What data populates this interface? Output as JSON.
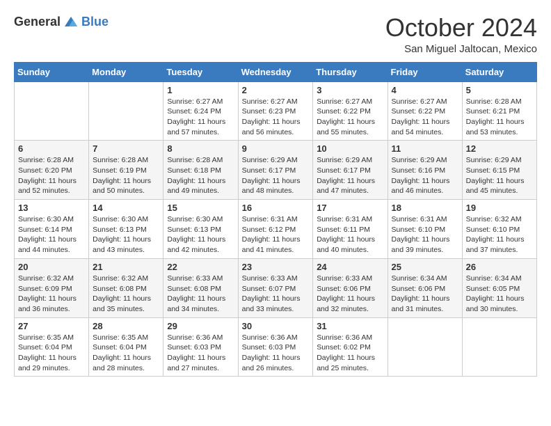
{
  "header": {
    "logo_general": "General",
    "logo_blue": "Blue",
    "month_title": "October 2024",
    "location": "San Miguel Jaltocan, Mexico"
  },
  "days_of_week": [
    "Sunday",
    "Monday",
    "Tuesday",
    "Wednesday",
    "Thursday",
    "Friday",
    "Saturday"
  ],
  "weeks": [
    [
      {
        "day": "",
        "info": ""
      },
      {
        "day": "",
        "info": ""
      },
      {
        "day": "1",
        "info": "Sunrise: 6:27 AM\nSunset: 6:24 PM\nDaylight: 11 hours and 57 minutes."
      },
      {
        "day": "2",
        "info": "Sunrise: 6:27 AM\nSunset: 6:23 PM\nDaylight: 11 hours and 56 minutes."
      },
      {
        "day": "3",
        "info": "Sunrise: 6:27 AM\nSunset: 6:22 PM\nDaylight: 11 hours and 55 minutes."
      },
      {
        "day": "4",
        "info": "Sunrise: 6:27 AM\nSunset: 6:22 PM\nDaylight: 11 hours and 54 minutes."
      },
      {
        "day": "5",
        "info": "Sunrise: 6:28 AM\nSunset: 6:21 PM\nDaylight: 11 hours and 53 minutes."
      }
    ],
    [
      {
        "day": "6",
        "info": "Sunrise: 6:28 AM\nSunset: 6:20 PM\nDaylight: 11 hours and 52 minutes."
      },
      {
        "day": "7",
        "info": "Sunrise: 6:28 AM\nSunset: 6:19 PM\nDaylight: 11 hours and 50 minutes."
      },
      {
        "day": "8",
        "info": "Sunrise: 6:28 AM\nSunset: 6:18 PM\nDaylight: 11 hours and 49 minutes."
      },
      {
        "day": "9",
        "info": "Sunrise: 6:29 AM\nSunset: 6:17 PM\nDaylight: 11 hours and 48 minutes."
      },
      {
        "day": "10",
        "info": "Sunrise: 6:29 AM\nSunset: 6:17 PM\nDaylight: 11 hours and 47 minutes."
      },
      {
        "day": "11",
        "info": "Sunrise: 6:29 AM\nSunset: 6:16 PM\nDaylight: 11 hours and 46 minutes."
      },
      {
        "day": "12",
        "info": "Sunrise: 6:29 AM\nSunset: 6:15 PM\nDaylight: 11 hours and 45 minutes."
      }
    ],
    [
      {
        "day": "13",
        "info": "Sunrise: 6:30 AM\nSunset: 6:14 PM\nDaylight: 11 hours and 44 minutes."
      },
      {
        "day": "14",
        "info": "Sunrise: 6:30 AM\nSunset: 6:13 PM\nDaylight: 11 hours and 43 minutes."
      },
      {
        "day": "15",
        "info": "Sunrise: 6:30 AM\nSunset: 6:13 PM\nDaylight: 11 hours and 42 minutes."
      },
      {
        "day": "16",
        "info": "Sunrise: 6:31 AM\nSunset: 6:12 PM\nDaylight: 11 hours and 41 minutes."
      },
      {
        "day": "17",
        "info": "Sunrise: 6:31 AM\nSunset: 6:11 PM\nDaylight: 11 hours and 40 minutes."
      },
      {
        "day": "18",
        "info": "Sunrise: 6:31 AM\nSunset: 6:10 PM\nDaylight: 11 hours and 39 minutes."
      },
      {
        "day": "19",
        "info": "Sunrise: 6:32 AM\nSunset: 6:10 PM\nDaylight: 11 hours and 37 minutes."
      }
    ],
    [
      {
        "day": "20",
        "info": "Sunrise: 6:32 AM\nSunset: 6:09 PM\nDaylight: 11 hours and 36 minutes."
      },
      {
        "day": "21",
        "info": "Sunrise: 6:32 AM\nSunset: 6:08 PM\nDaylight: 11 hours and 35 minutes."
      },
      {
        "day": "22",
        "info": "Sunrise: 6:33 AM\nSunset: 6:08 PM\nDaylight: 11 hours and 34 minutes."
      },
      {
        "day": "23",
        "info": "Sunrise: 6:33 AM\nSunset: 6:07 PM\nDaylight: 11 hours and 33 minutes."
      },
      {
        "day": "24",
        "info": "Sunrise: 6:33 AM\nSunset: 6:06 PM\nDaylight: 11 hours and 32 minutes."
      },
      {
        "day": "25",
        "info": "Sunrise: 6:34 AM\nSunset: 6:06 PM\nDaylight: 11 hours and 31 minutes."
      },
      {
        "day": "26",
        "info": "Sunrise: 6:34 AM\nSunset: 6:05 PM\nDaylight: 11 hours and 30 minutes."
      }
    ],
    [
      {
        "day": "27",
        "info": "Sunrise: 6:35 AM\nSunset: 6:04 PM\nDaylight: 11 hours and 29 minutes."
      },
      {
        "day": "28",
        "info": "Sunrise: 6:35 AM\nSunset: 6:04 PM\nDaylight: 11 hours and 28 minutes."
      },
      {
        "day": "29",
        "info": "Sunrise: 6:36 AM\nSunset: 6:03 PM\nDaylight: 11 hours and 27 minutes."
      },
      {
        "day": "30",
        "info": "Sunrise: 6:36 AM\nSunset: 6:03 PM\nDaylight: 11 hours and 26 minutes."
      },
      {
        "day": "31",
        "info": "Sunrise: 6:36 AM\nSunset: 6:02 PM\nDaylight: 11 hours and 25 minutes."
      },
      {
        "day": "",
        "info": ""
      },
      {
        "day": "",
        "info": ""
      }
    ]
  ]
}
